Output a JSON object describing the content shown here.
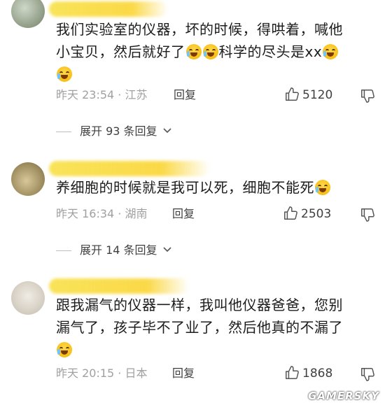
{
  "comments": [
    {
      "text_parts": [
        "我们实验室的仪器，坏的时候，得哄着，喊他\n小宝贝，然后就好了",
        "科学的尽头是xx",
        ""
      ],
      "time_location": "昨天 23:54 · 江苏",
      "reply_label": "回复",
      "likes": "5120",
      "expand_label": "展开 93 条回复"
    },
    {
      "text_parts": [
        "养细胞的时候就是我可以死，细胞不能死"
      ],
      "time_location": "昨天 16:34 · 湖南",
      "reply_label": "回复",
      "likes": "2503",
      "expand_label": "展开 14 条回复"
    },
    {
      "text_parts": [
        "跟我漏气的仪器一样，我叫他仪器爸爸，您别\n漏气了，孩子毕不了业了，然后他真的不漏了"
      ],
      "time_location": "昨天 20:15 · 日本",
      "reply_label": "回复",
      "likes": "1868"
    }
  ],
  "watermark": "GAMERSKY",
  "icons": {
    "emoji": "laugh-cry-emoji-icon",
    "like": "thumbs-up-icon",
    "dislike": "thumbs-down-icon",
    "chevron": "chevron-down-icon"
  }
}
